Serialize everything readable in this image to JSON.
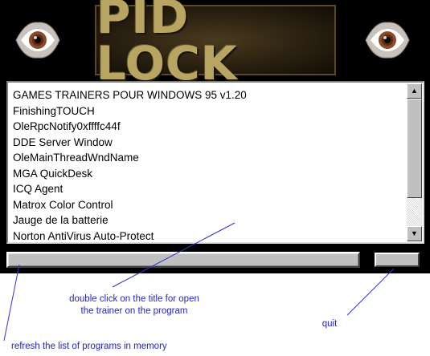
{
  "app": {
    "logo_text": "PID LOCK"
  },
  "icons": {
    "left_eye": "eye-icon",
    "right_eye": "eye-icon"
  },
  "program_list": {
    "items": [
      "GAMES TRAINERS POUR WINDOWS 95  v1.20",
      "FinishingTOUCH",
      "OleRpcNotify0xffffc44f",
      "DDE Server Window",
      "OleMainThreadWndName",
      "MGA QuickDesk",
      "ICQ Agent",
      "Matrox Color Control",
      "Jauge de la batterie",
      "Norton AntiVirus Auto-Protect"
    ]
  },
  "annotations": {
    "double_click_line1": "double click on the title for open",
    "double_click_line2": "the trainer on the program",
    "quit": "quit",
    "refresh": "refresh the list of programs in memory"
  },
  "colors": {
    "window_background": "#000000",
    "logo_text": "#b7a561",
    "annotation_text": "#2323c8",
    "button_face": "#c0c0c0"
  }
}
